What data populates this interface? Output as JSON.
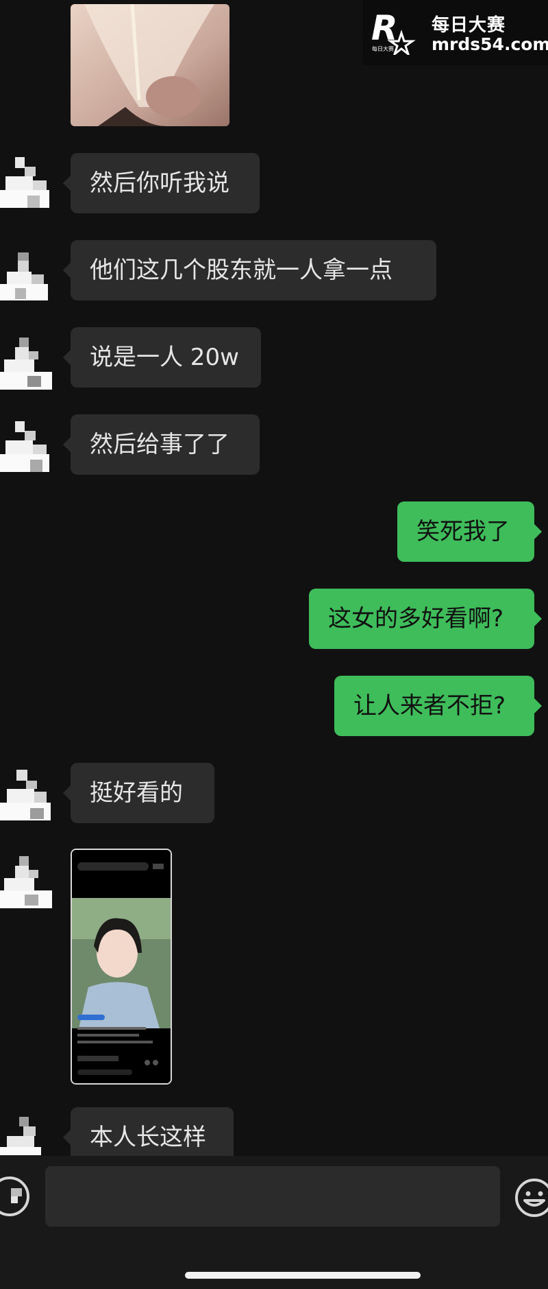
{
  "watermark": {
    "title": "每日大赛",
    "url": "mrds54.com",
    "logo_letter": "R",
    "logo_subtext": "每日大赛"
  },
  "messages": [
    {
      "side": "in",
      "type": "image",
      "description": "photo",
      "icon": "photo-thumbnail"
    },
    {
      "side": "in",
      "type": "text",
      "text": "然后你听我说"
    },
    {
      "side": "in",
      "type": "text",
      "text": "他们这几个股东就一人拿一点"
    },
    {
      "side": "in",
      "type": "text",
      "text": "说是一人 20w"
    },
    {
      "side": "in",
      "type": "text",
      "text": "然后给事了了"
    },
    {
      "side": "out",
      "type": "text",
      "text": "笑死我了"
    },
    {
      "side": "out",
      "type": "text",
      "text": "这女的多好看啊?"
    },
    {
      "side": "out",
      "type": "text",
      "text": "让人来者不拒?"
    },
    {
      "side": "in",
      "type": "text",
      "text": " 挺好看的"
    },
    {
      "side": "in",
      "type": "image",
      "icon": "video-screenshot"
    },
    {
      "side": "in",
      "type": "text",
      "text": "本人长这样"
    }
  ],
  "input_bar": {
    "voice_icon": "voice-icon",
    "emoji_icon": "emoji-icon"
  },
  "colors": {
    "background": "#111111",
    "bubble_in": "#2c2c2c",
    "bubble_out": "#3ebd5a",
    "text_in": "#e6e6e6"
  }
}
